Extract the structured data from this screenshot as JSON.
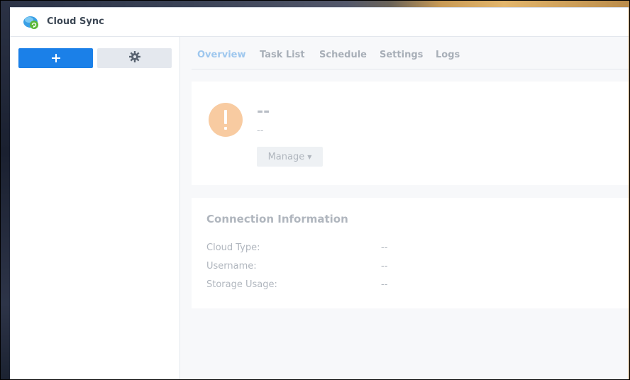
{
  "app": {
    "title": "Cloud Sync",
    "icon": "cloud-sync-icon"
  },
  "sidebar": {
    "add_button_icon": "plus-icon",
    "settings_button_icon": "gear-icon"
  },
  "tabs": [
    {
      "label": "Overview",
      "active": true
    },
    {
      "label": "Task List",
      "active": false
    },
    {
      "label": "Schedule",
      "active": false
    },
    {
      "label": "Settings",
      "active": false
    },
    {
      "label": "Logs",
      "active": false
    }
  ],
  "status": {
    "icon": "warning-icon",
    "title": "--",
    "subtitle": "--",
    "manage_label": "Manage"
  },
  "connection": {
    "title": "Connection Information",
    "rows": [
      {
        "label": "Cloud Type:",
        "value": "--"
      },
      {
        "label": "Username:",
        "value": "--"
      },
      {
        "label": "Storage Usage:",
        "value": "--"
      }
    ]
  },
  "colors": {
    "accent": "#1b80e8",
    "warning": "#f8cba1",
    "active_tab": "#9ec7ee"
  }
}
